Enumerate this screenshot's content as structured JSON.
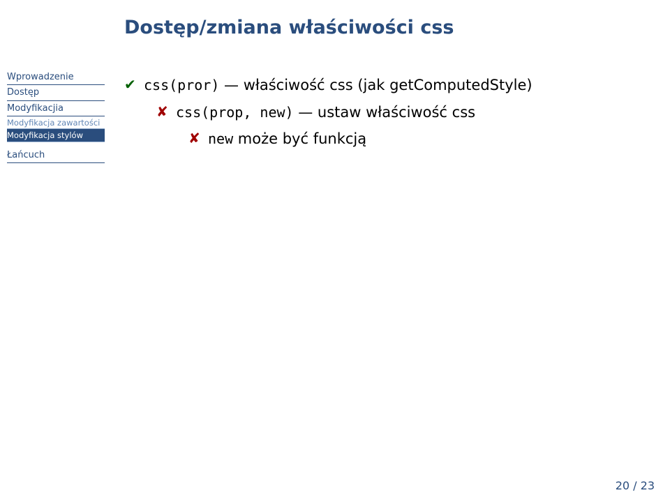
{
  "title": "Dostęp/zmiana właściwości css",
  "sidebar": {
    "items": [
      {
        "label": "Wprowadzenie",
        "type": "main"
      },
      {
        "label": "Dostęp",
        "type": "main"
      },
      {
        "label": "Modyfikacjia",
        "type": "main"
      },
      {
        "label": "Modyfikacja zawartości",
        "type": "sub"
      },
      {
        "label": "Modyfikacja stylów",
        "type": "sub-active"
      },
      {
        "label": "Łańcuch",
        "type": "main"
      }
    ]
  },
  "content": {
    "line1_code": "css(pror)",
    "line1_rest": " — właściwość css (jak getComputedStyle)",
    "line2_code": "css(prop, new)",
    "line2_rest": " — ustaw właściwość css",
    "line3_code": "new",
    "line3_rest": " może być funkcją"
  },
  "page": {
    "cur": "20",
    "total": "23"
  },
  "bullets": {
    "check": "✔",
    "x": "✘"
  }
}
